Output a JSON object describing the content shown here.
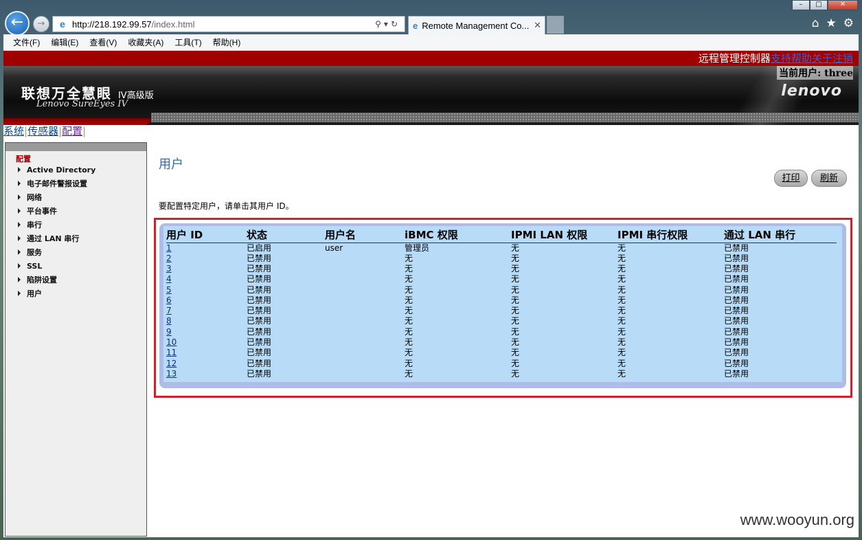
{
  "browser": {
    "url_host": "http://218.192.99.57",
    "url_path": "/index.html",
    "tab_title": "Remote Management Co...",
    "menu": [
      "文件(F)",
      "编辑(E)",
      "查看(V)",
      "收藏夹(A)",
      "工具(T)",
      "帮助(H)"
    ]
  },
  "header": {
    "controller_title": "远程管理控制器",
    "links": [
      "支持",
      "帮助",
      "关于",
      "注销"
    ],
    "current_user": "当前用户: three",
    "product_name": "联想万全慧眼",
    "product_edition": "IV高级版",
    "product_subtitle": "Lenovo SureEyes IV",
    "brand": "lenovo"
  },
  "topnav": [
    "系统",
    "传感器",
    "配置"
  ],
  "sidebar": {
    "title": "配置",
    "items": [
      "Active Directory",
      "电子邮件警报设置",
      "网络",
      "平台事件",
      "串行",
      "通过 LAN 串行",
      "服务",
      "SSL",
      "陷阱设置",
      "用户"
    ]
  },
  "main": {
    "title": "用户",
    "print_label": "打印",
    "refresh_label": "刷新",
    "hint": "要配置特定用户，请单击其用户 ID。",
    "columns": [
      "用户 ID",
      "状态",
      "用户名",
      "iBMC 权限",
      "IPMI LAN 权限",
      "IPMI 串行权限",
      "通过 LAN 串行"
    ],
    "rows": [
      [
        "1",
        "已启用",
        "user",
        "管理员",
        "无",
        "无",
        "已禁用"
      ],
      [
        "2",
        "已禁用",
        "",
        "无",
        "无",
        "无",
        "已禁用"
      ],
      [
        "3",
        "已禁用",
        "",
        "无",
        "无",
        "无",
        "已禁用"
      ],
      [
        "4",
        "已禁用",
        "",
        "无",
        "无",
        "无",
        "已禁用"
      ],
      [
        "5",
        "已禁用",
        "",
        "无",
        "无",
        "无",
        "已禁用"
      ],
      [
        "6",
        "已禁用",
        "",
        "无",
        "无",
        "无",
        "已禁用"
      ],
      [
        "7",
        "已禁用",
        "",
        "无",
        "无",
        "无",
        "已禁用"
      ],
      [
        "8",
        "已禁用",
        "",
        "无",
        "无",
        "无",
        "已禁用"
      ],
      [
        "9",
        "已禁用",
        "",
        "无",
        "无",
        "无",
        "已禁用"
      ],
      [
        "10",
        "已禁用",
        "",
        "无",
        "无",
        "无",
        "已禁用"
      ],
      [
        "11",
        "已禁用",
        "",
        "无",
        "无",
        "无",
        "已禁用"
      ],
      [
        "12",
        "已禁用",
        "",
        "无",
        "无",
        "无",
        "已禁用"
      ],
      [
        "13",
        "已禁用",
        "",
        "无",
        "无",
        "无",
        "已禁用"
      ]
    ]
  },
  "watermark": "www.wooyun.org"
}
